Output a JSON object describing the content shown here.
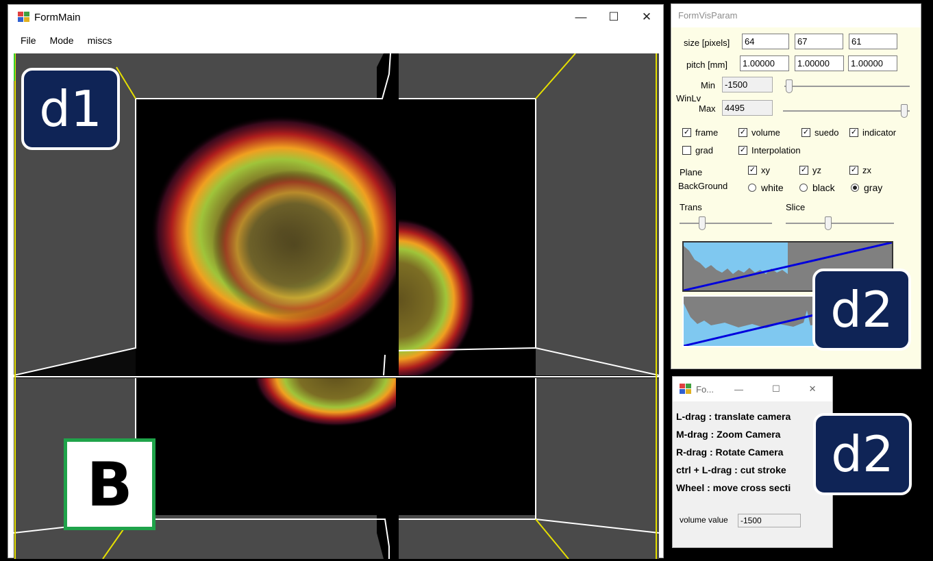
{
  "main_window": {
    "title": "FormMain",
    "controls": {
      "minimize": "—",
      "maximize": "☐",
      "close": "✕"
    },
    "menu": [
      "File",
      "Mode",
      "miscs"
    ]
  },
  "annotations": {
    "d1": "d1",
    "d2_top": "d2",
    "d2_bottom": "d2",
    "b": "B"
  },
  "vis_param": {
    "title": "FormVisParam",
    "size_label": "size [pixels]",
    "size_values": [
      "64",
      "67",
      "61"
    ],
    "pitch_label": "pitch [mm]",
    "pitch_values": [
      "1.00000",
      "1.00000",
      "1.00000"
    ],
    "winlv_label": "WinLv",
    "min_label": "Min",
    "min_value": "-1500",
    "max_label": "Max",
    "max_value": "4495",
    "checkboxes_row1": [
      {
        "label": "frame",
        "checked": true
      },
      {
        "label": "volume",
        "checked": true
      },
      {
        "label": "suedo",
        "checked": true
      },
      {
        "label": "indicator",
        "checked": true
      }
    ],
    "checkboxes_row2": [
      {
        "label": "grad",
        "checked": false
      },
      {
        "label": "Interpolation",
        "checked": true
      }
    ],
    "plane_label": "Plane",
    "planes": [
      {
        "label": "xy",
        "checked": true
      },
      {
        "label": "yz",
        "checked": true
      },
      {
        "label": "zx",
        "checked": true
      }
    ],
    "background_label": "BackGround",
    "backgrounds": [
      {
        "label": "white",
        "selected": false
      },
      {
        "label": "black",
        "selected": false
      },
      {
        "label": "gray",
        "selected": true
      }
    ],
    "trans_label": "Trans",
    "slice_label": "Slice",
    "sliders": {
      "min_level": 0.02,
      "max_level": 0.98,
      "trans_level": 0.2,
      "slice_level": 0.45
    }
  },
  "help_window": {
    "title": "Fo...",
    "controls": {
      "minimize": "—",
      "maximize": "☐",
      "close": "✕"
    },
    "lines": [
      "L-drag : translate camera",
      "M-drag : Zoom Camera",
      "R-drag : Rotate Camera",
      "ctrl + L-drag : cut stroke",
      "Wheel : move cross secti"
    ],
    "volume_label": "volume value",
    "volume_value": "-1500"
  },
  "colors": {
    "badge_navy": "#0f2456",
    "badge_green": "#1fa34a",
    "frame_yellow": "#e6e000",
    "panel_cream": "#fdfde6",
    "histogram_fill": "#7fc8f0",
    "histogram_line": "#0000dd"
  }
}
